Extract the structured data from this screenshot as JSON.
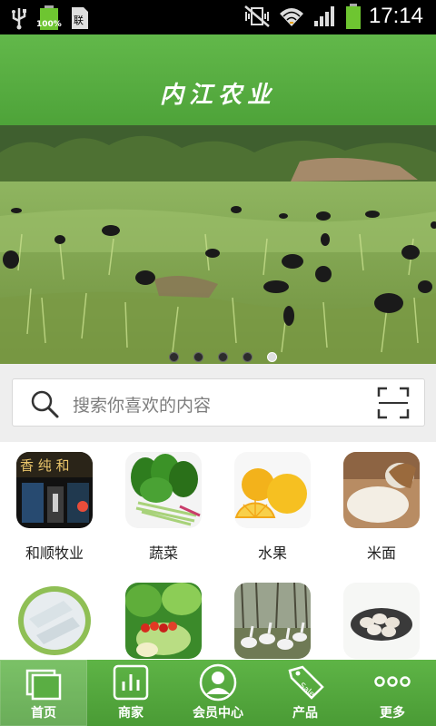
{
  "status_bar": {
    "time": "17:14",
    "battery_label": "100%",
    "left_icons": [
      "usb-icon",
      "battery-charging-icon",
      "sim-card-icon"
    ],
    "right_icons": [
      "vibrate-mute-icon",
      "wifi-icon",
      "signal-icon",
      "battery-icon"
    ]
  },
  "header": {
    "title": "内江农业"
  },
  "banner": {
    "slide_count": 5,
    "active_slide_index": 4
  },
  "search": {
    "placeholder": "搜索你喜欢的内容"
  },
  "categories": [
    {
      "label": "和顺牧业",
      "image": "store-front-photo"
    },
    {
      "label": "蔬菜",
      "image": "spinach-photo"
    },
    {
      "label": "水果",
      "image": "lemon-photo"
    },
    {
      "label": "米面",
      "image": "rice-photo"
    },
    {
      "label": "",
      "image": "fish-fillet-photo"
    },
    {
      "label": "",
      "image": "salad-vegetables-photo"
    },
    {
      "label": "",
      "image": "geese-photo"
    },
    {
      "label": "",
      "image": "eggs-photo"
    }
  ],
  "tabbar": {
    "tabs": [
      {
        "label": "首页",
        "icon": "home-stack-icon",
        "active": true
      },
      {
        "label": "商家",
        "icon": "merchant-chart-icon",
        "active": false
      },
      {
        "label": "会员中心",
        "icon": "member-avatar-icon",
        "active": false
      },
      {
        "label": "产品",
        "icon": "sale-tag-icon",
        "active": false
      },
      {
        "label": "更多",
        "icon": "more-dots-icon",
        "active": false
      }
    ]
  },
  "colors": {
    "brand_green": "#5aae43",
    "tab_green": "#4a9b35",
    "search_bg": "#eeeeee"
  }
}
